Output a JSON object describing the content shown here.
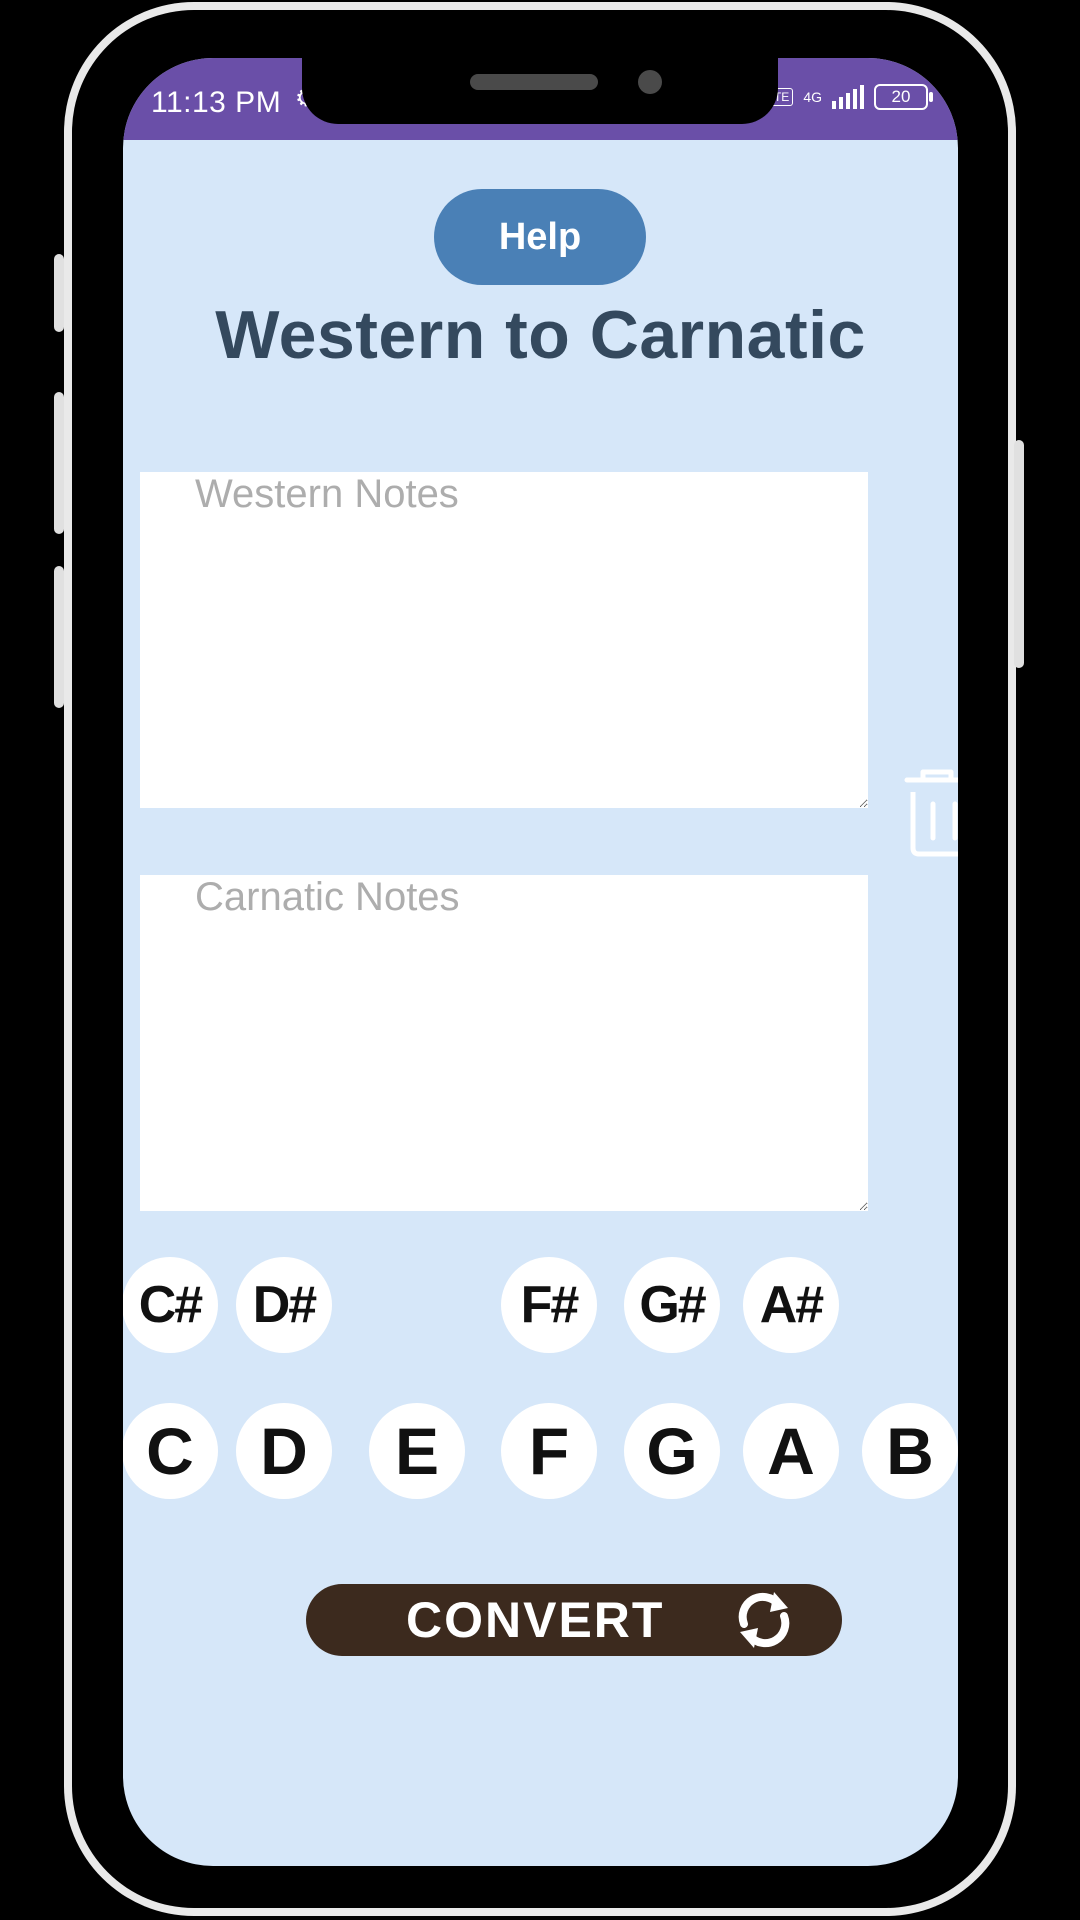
{
  "status_bar": {
    "time": "11:13 PM",
    "network": "4G",
    "lte": "LTE",
    "battery": "20"
  },
  "help_label": "Help",
  "title": "Western to Carnatic",
  "western_input": {
    "value": "",
    "placeholder": "Western Notes"
  },
  "carnatic_output": {
    "value": "",
    "placeholder": "Carnatic Notes"
  },
  "sharp_keys": [
    "C#",
    "D#",
    "F#",
    "G#",
    "A#"
  ],
  "natural_keys": [
    "C",
    "D",
    "E",
    "F",
    "G",
    "A",
    "B"
  ],
  "convert_label": "CONVERT",
  "colors": {
    "background": "#d6e7f9",
    "status_bar": "#6a4fa8",
    "help_button": "#4a80b6",
    "title": "#34495e",
    "convert_button": "#3c2a1e"
  },
  "icons": {
    "delete": "trash-icon",
    "convert": "refresh-arrows-icon",
    "settings": "gear-icon"
  }
}
